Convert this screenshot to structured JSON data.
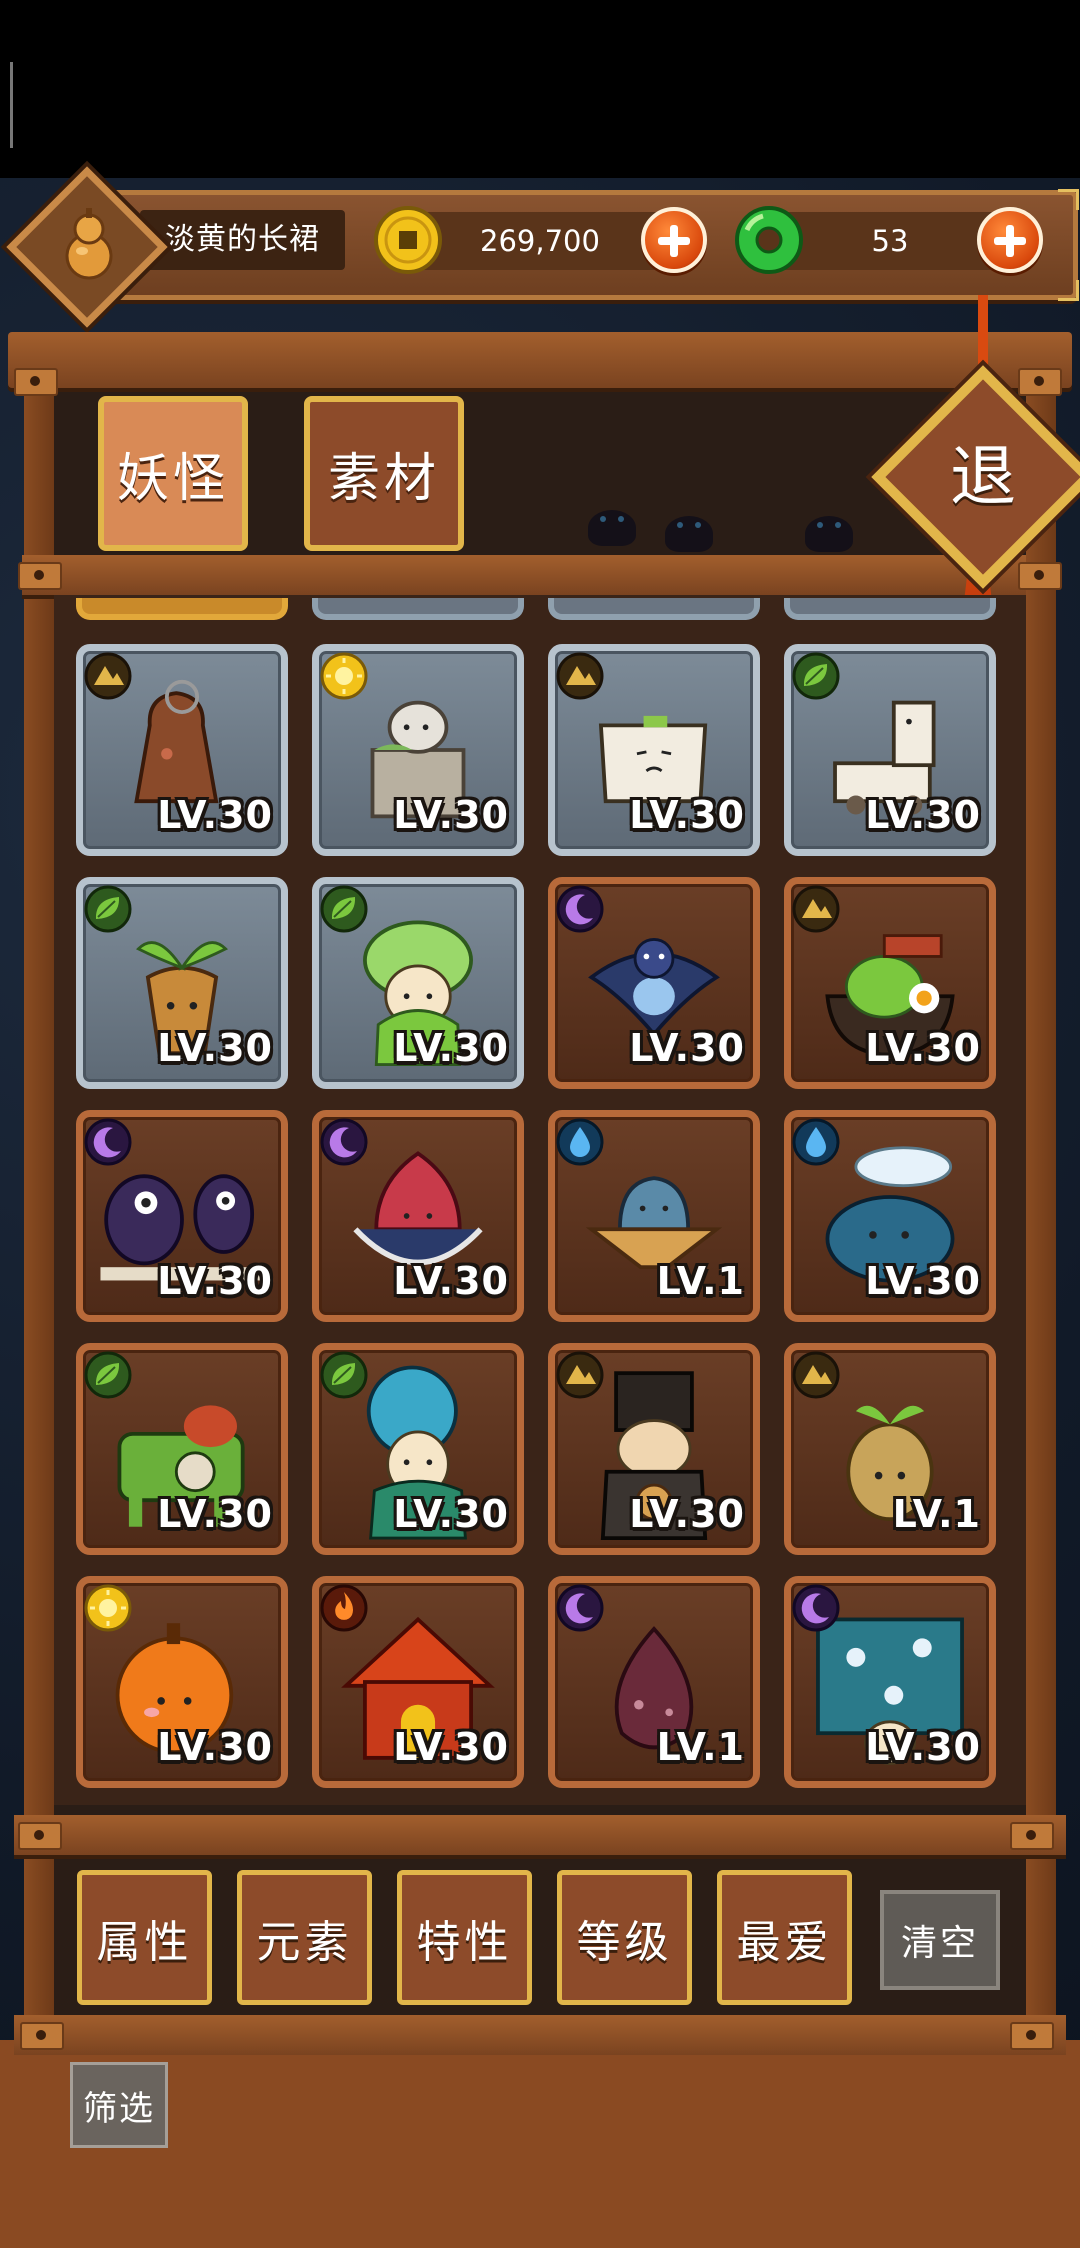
{
  "header": {
    "player_name": "淡黄的长裙",
    "gold_amount": "269,700",
    "jade_amount": "53",
    "icons": [
      "gourd-avatar-icon",
      "gold-coin-icon",
      "jade-icon",
      "plus-icon"
    ],
    "colors": {
      "accent_gold": "#e2b64a",
      "plus_orange": "#d9480c",
      "jade_green": "#22b33a"
    }
  },
  "tabs": [
    {
      "label": "妖怪",
      "selected": true
    },
    {
      "label": "素材",
      "selected": false
    }
  ],
  "exit_label": "退",
  "cards": [
    {
      "name": "bell",
      "level": "LV.30",
      "element": "earth",
      "frame": "silver"
    },
    {
      "name": "stone-cat",
      "level": "LV.30",
      "element": "sun",
      "frame": "silver"
    },
    {
      "name": "tofu",
      "level": "LV.30",
      "element": "earth",
      "frame": "silver"
    },
    {
      "name": "cart-horse",
      "level": "LV.30",
      "element": "leaf",
      "frame": "silver"
    },
    {
      "name": "sprout-root",
      "level": "LV.30",
      "element": "leaf",
      "frame": "silver"
    },
    {
      "name": "leaf-girl",
      "level": "LV.30",
      "element": "leaf",
      "frame": "silver"
    },
    {
      "name": "blue-swallow",
      "level": "LV.30",
      "element": "moon",
      "frame": "bronze"
    },
    {
      "name": "noodle-bowl",
      "level": "LV.30",
      "element": "earth",
      "frame": "bronze"
    },
    {
      "name": "ghost-pair",
      "level": "LV.30",
      "element": "moon",
      "frame": "bronze"
    },
    {
      "name": "red-squid",
      "level": "LV.30",
      "element": "moon",
      "frame": "bronze"
    },
    {
      "name": "hat-ghost",
      "level": "LV.1",
      "element": "water",
      "frame": "bronze"
    },
    {
      "name": "cloud-whale",
      "level": "LV.30",
      "element": "water",
      "frame": "bronze"
    },
    {
      "name": "bamboo-ox",
      "level": "LV.30",
      "element": "leaf",
      "frame": "bronze"
    },
    {
      "name": "teal-lady",
      "level": "LV.30",
      "element": "leaf",
      "frame": "bronze"
    },
    {
      "name": "constable",
      "level": "LV.30",
      "element": "earth",
      "frame": "bronze"
    },
    {
      "name": "potato-sprout",
      "level": "LV.1",
      "element": "earth",
      "frame": "bronze"
    },
    {
      "name": "orange-fruit",
      "level": "LV.30",
      "element": "sun",
      "frame": "bronze"
    },
    {
      "name": "red-house",
      "level": "LV.30",
      "element": "fire",
      "frame": "bronze"
    },
    {
      "name": "onion",
      "level": "LV.1",
      "element": "moon",
      "frame": "bronze"
    },
    {
      "name": "curtain-spirit",
      "level": "LV.30",
      "element": "moon",
      "frame": "bronze"
    }
  ],
  "filters": [
    "属性",
    "元素",
    "特性",
    "等级",
    "最爱"
  ],
  "clear_label": "清空",
  "screen_label": "筛选"
}
